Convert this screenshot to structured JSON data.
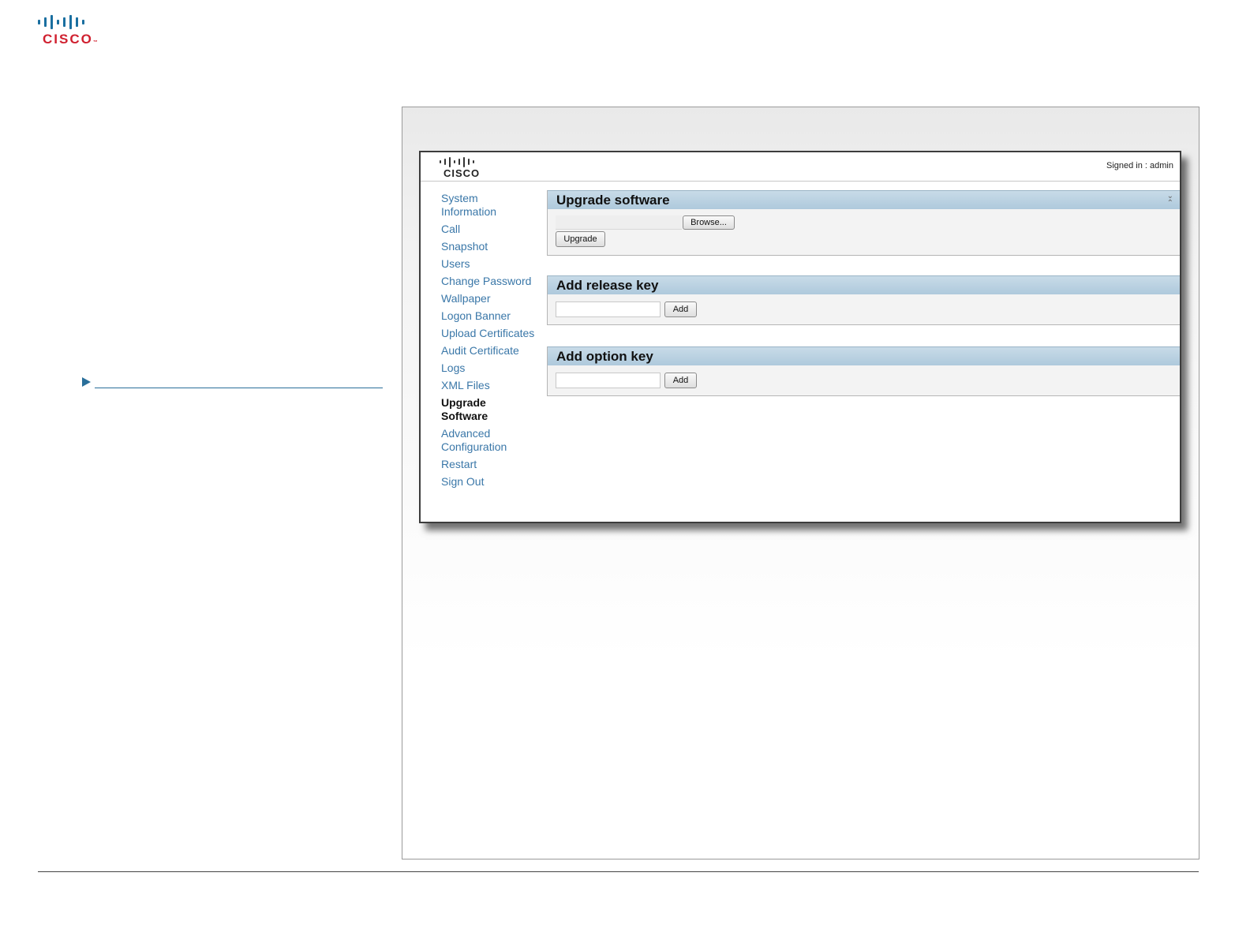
{
  "brand": {
    "logo_text": "CISCO",
    "trademark": "™",
    "colors": {
      "logo_red": "#d0202f",
      "logo_blue": "#1a6fa0",
      "link_blue": "#3a77a8",
      "section_header": "#aec9dc"
    }
  },
  "app": {
    "logo_text": "CISCO",
    "signed_in": "Signed in : admin"
  },
  "nav": {
    "items": [
      {
        "label": "System Information",
        "active": false
      },
      {
        "label": "Call",
        "active": false
      },
      {
        "label": "Snapshot",
        "active": false
      },
      {
        "label": "Users",
        "active": false
      },
      {
        "label": "Change Password",
        "active": false
      },
      {
        "label": "Wallpaper",
        "active": false
      },
      {
        "label": "Logon Banner",
        "active": false
      },
      {
        "label": "Upload Certificates",
        "active": false
      },
      {
        "label": "Audit Certificate",
        "active": false
      },
      {
        "label": "Logs",
        "active": false
      },
      {
        "label": "XML Files",
        "active": false
      },
      {
        "label": "Upgrade Software",
        "active": true
      },
      {
        "label": "Advanced Configuration",
        "active": false
      },
      {
        "label": "Restart",
        "active": false
      },
      {
        "label": "Sign Out",
        "active": false
      }
    ]
  },
  "sections": {
    "upgrade": {
      "title": "Upgrade software",
      "browse_label": "Browse...",
      "upgrade_label": "Upgrade",
      "file_value": ""
    },
    "release_key": {
      "title": "Add release key",
      "input_value": "",
      "add_label": "Add"
    },
    "option_key": {
      "title": "Add option key",
      "input_value": "",
      "add_label": "Add"
    }
  }
}
